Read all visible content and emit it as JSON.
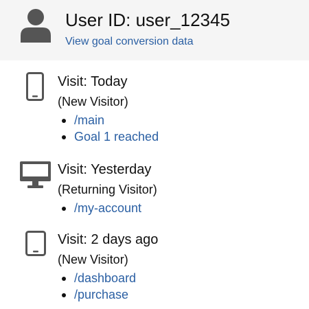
{
  "header": {
    "user_id": "User ID: user_12345",
    "goal_link": "View goal conversion data",
    "avatar_icon": "user-avatar-icon"
  },
  "visits": [
    {
      "device_icon": "smartphone-icon",
      "title": "Visit: Today",
      "visitor_type": "(New Visitor)",
      "pages": [
        "/main",
        "Goal 1 reached"
      ]
    },
    {
      "device_icon": "desktop-icon",
      "title": "Visit: Yesterday",
      "visitor_type": "(Returning Visitor)",
      "pages": [
        "/my-account"
      ]
    },
    {
      "device_icon": "tablet-icon",
      "title": "Visit: 2 days ago",
      "visitor_type": "(New Visitor)",
      "pages": [
        "/dashboard",
        "/purchase"
      ]
    }
  ],
  "colors": {
    "link": "#2a5fa3",
    "icon": "#555555",
    "header_bg": "#f5f5f5"
  }
}
